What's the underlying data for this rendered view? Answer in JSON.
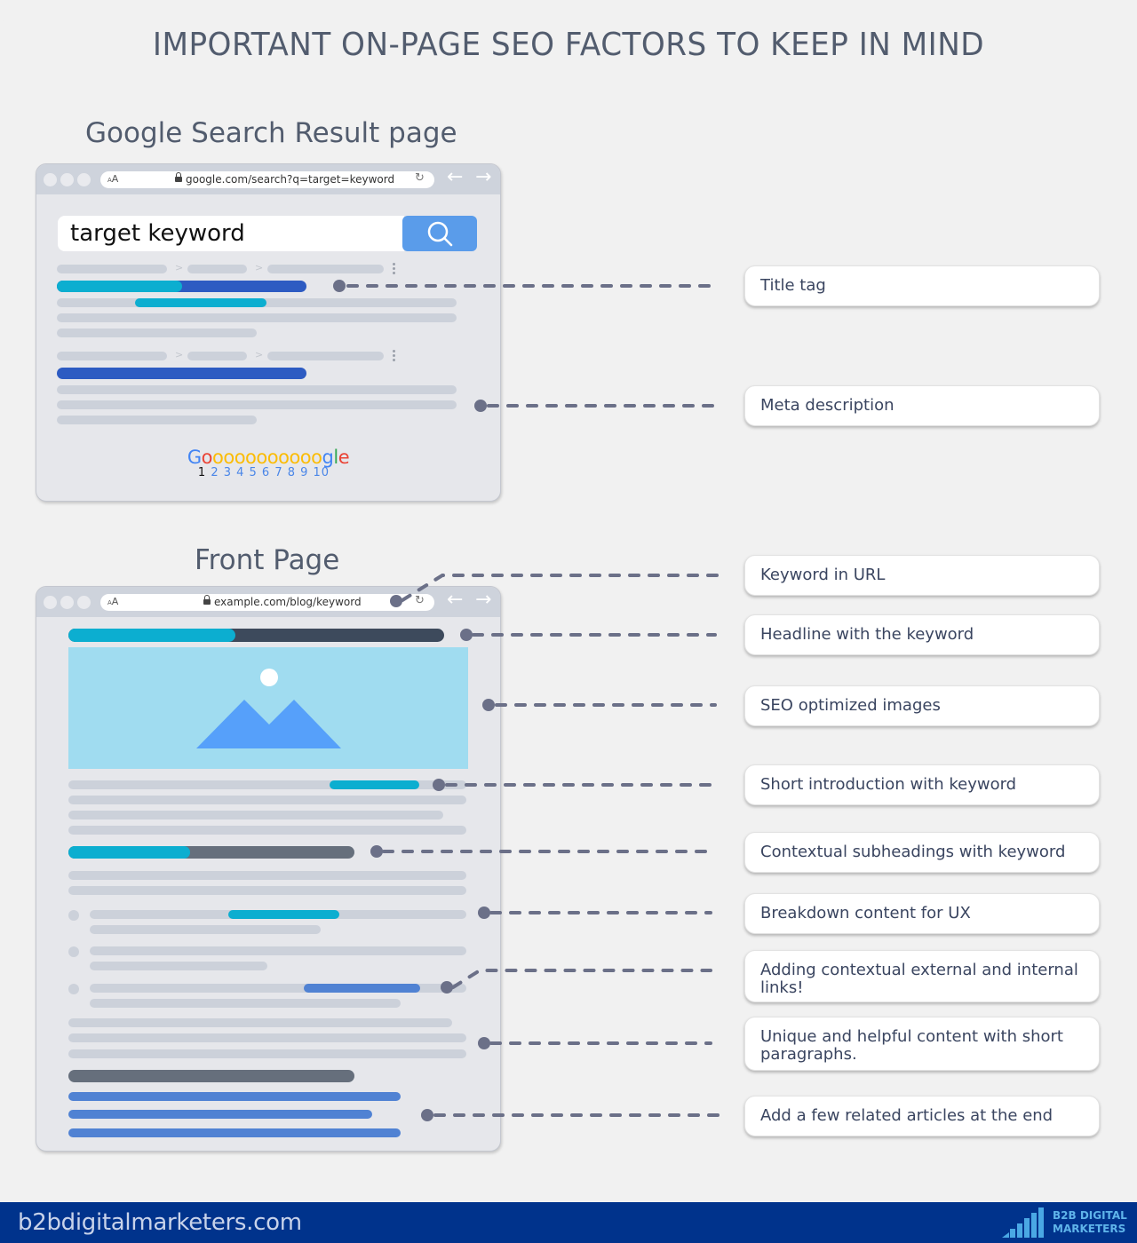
{
  "title": "IMPORTANT ON-PAGE SEO FACTORS TO KEEP IN MIND",
  "serp": {
    "section_title": "Google Search Result page",
    "url_aa_small": "A",
    "url_aa_large": "A",
    "url": "google.com/search?q=target=keyword",
    "search_query": "target keyword",
    "pagination_logo": {
      "letters": [
        {
          "ch": "G",
          "color": "#4285f4"
        },
        {
          "ch": "o",
          "color": "#ea4335"
        },
        {
          "ch": "oooooooooo",
          "color": "#fbbc05"
        },
        {
          "ch": "g",
          "color": "#4285f4"
        },
        {
          "ch": "l",
          "color": "#34a853"
        },
        {
          "ch": "e",
          "color": "#ea4335"
        }
      ],
      "current_page": "1",
      "other_pages": "2 3 4 5 6 7 8 9 10"
    }
  },
  "front": {
    "section_title": "Front Page",
    "url_aa_small": "A",
    "url_aa_large": "A",
    "url": "example.com/blog/keyword"
  },
  "callouts": [
    {
      "label": "Title tag"
    },
    {
      "label": "Meta description"
    },
    {
      "label": "Keyword in URL"
    },
    {
      "label": "Headline with the keyword"
    },
    {
      "label": "SEO optimized images"
    },
    {
      "label": "Short introduction with keyword"
    },
    {
      "label": "Contextual subheadings with keyword"
    },
    {
      "label": "Breakdown content for UX"
    },
    {
      "label": "Adding contextual external and internal links!"
    },
    {
      "label": "Unique and helpful content with short paragraphs."
    },
    {
      "label": "Add a few related articles at the end"
    }
  ],
  "footer": {
    "domain": "b2bdigitalmarketers.com",
    "logo_line1": "B2B DIGITAL",
    "logo_line2": "MARKETERS"
  },
  "colors": {
    "keyword_highlight": "#0caed0",
    "serp_title": "#2d5bc2",
    "link": "#5082d3",
    "connector": "#6b7088",
    "footer_bg": "#00338c"
  }
}
